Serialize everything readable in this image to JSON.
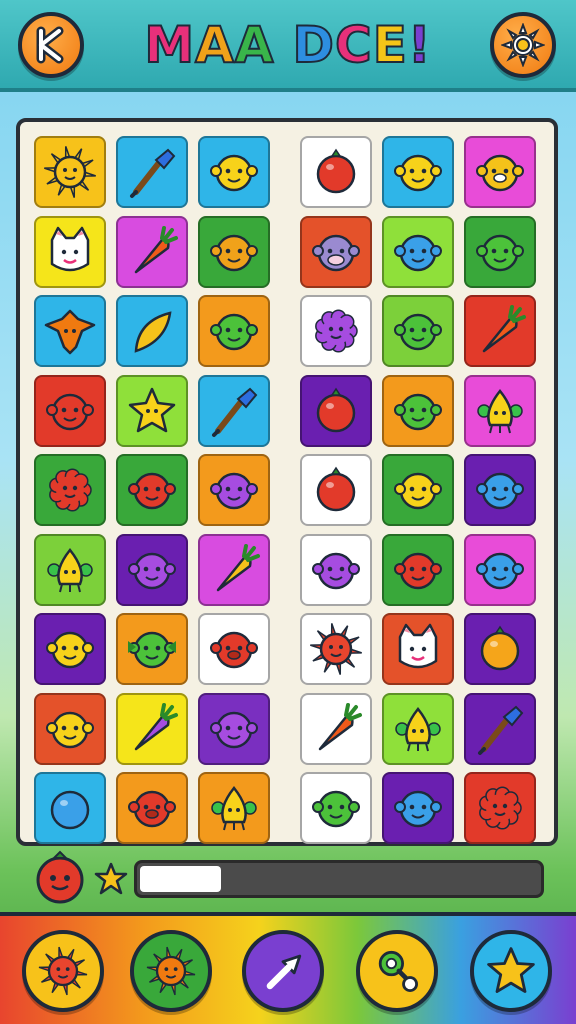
{
  "header": {
    "title_letters": [
      {
        "ch": "M",
        "color": "#e8307a"
      },
      {
        "ch": "A",
        "color": "#f0a21a"
      },
      {
        "ch": "A",
        "color": "#39b54a"
      },
      {
        "ch": " ",
        "color": "#000000"
      },
      {
        "ch": "D",
        "color": "#2d8ee0"
      },
      {
        "ch": "C",
        "color": "#e8307a"
      },
      {
        "ch": "E",
        "color": "#f5c518"
      },
      {
        "ch": "!",
        "color": "#7a3fd0"
      }
    ],
    "back_icon": "back-arrow-icon",
    "settings_icon": "sun-gear-icon"
  },
  "board": {
    "rows": [
      [
        {
          "bg": "#f7c21a",
          "icon": "sun"
        },
        {
          "bg": "#2fb5e8",
          "icon": "brush"
        },
        {
          "bg": "#2fb5e8",
          "icon": "yellow-face"
        },
        {
          "bg": "#ffffff",
          "icon": "red-ball"
        },
        {
          "bg": "#2fb5e8",
          "icon": "yellow-face"
        },
        {
          "bg": "#e84cd8",
          "icon": "dog"
        }
      ],
      [
        {
          "bg": "#f5e51a",
          "icon": "cat"
        },
        {
          "bg": "#d84ce0",
          "icon": "carrot"
        },
        {
          "bg": "#39a83a",
          "icon": "orange-face"
        },
        {
          "bg": "#e4522a",
          "icon": "cow"
        },
        {
          "bg": "#8fe03a",
          "icon": "blue-face"
        },
        {
          "bg": "#39a83a",
          "icon": "green-face"
        }
      ],
      [
        {
          "bg": "#2fb5e8",
          "icon": "bat"
        },
        {
          "bg": "#2fb5e8",
          "icon": "leaf"
        },
        {
          "bg": "#f39a1c",
          "icon": "green-face"
        },
        {
          "bg": "#ffffff",
          "icon": "purple-fluff"
        },
        {
          "bg": "#7cd03a",
          "icon": "green-face"
        },
        {
          "bg": "#e23a2a",
          "icon": "carrot"
        }
      ],
      [
        {
          "bg": "#e23a2a",
          "icon": "red-face"
        },
        {
          "bg": "#8fe03a",
          "icon": "yellow-star"
        },
        {
          "bg": "#2fb5e8",
          "icon": "brush"
        },
        {
          "bg": "#6a1fb0",
          "icon": "red-ball"
        },
        {
          "bg": "#f39a1c",
          "icon": "green-face"
        },
        {
          "bg": "#e84cd8",
          "icon": "yellow-drop"
        }
      ],
      [
        {
          "bg": "#39a83a",
          "icon": "red-fluff"
        },
        {
          "bg": "#39a83a",
          "icon": "red-face"
        },
        {
          "bg": "#f39a1c",
          "icon": "purple-face"
        },
        {
          "bg": "#ffffff",
          "icon": "red-ball"
        },
        {
          "bg": "#39a83a",
          "icon": "yellow-face"
        },
        {
          "bg": "#6a1fb0",
          "icon": "blue-face"
        }
      ],
      [
        {
          "bg": "#7cd03a",
          "icon": "yellow-drop"
        },
        {
          "bg": "#6a1fb0",
          "icon": "purple-face"
        },
        {
          "bg": "#d84ce0",
          "icon": "yellow-carrot"
        },
        {
          "bg": "#ffffff",
          "icon": "purple-face"
        },
        {
          "bg": "#39a83a",
          "icon": "red-face"
        },
        {
          "bg": "#e84cd8",
          "icon": "blue-face"
        }
      ],
      [
        {
          "bg": "#6a1fb0",
          "icon": "yellow-face"
        },
        {
          "bg": "#f39a1c",
          "icon": "green-bat"
        },
        {
          "bg": "#ffffff",
          "icon": "red-dog"
        },
        {
          "bg": "#ffffff",
          "icon": "red-sun"
        },
        {
          "bg": "#e4522a",
          "icon": "cat"
        },
        {
          "bg": "#6a1fb0",
          "icon": "orange-ball"
        }
      ],
      [
        {
          "bg": "#e4522a",
          "icon": "yellow-face"
        },
        {
          "bg": "#f5e51a",
          "icon": "eggplant"
        },
        {
          "bg": "#7a2fc0",
          "icon": "purple-face"
        },
        {
          "bg": "#ffffff",
          "icon": "carrot"
        },
        {
          "bg": "#8fe03a",
          "icon": "yellow-drop"
        },
        {
          "bg": "#6a1fb0",
          "icon": "brush"
        }
      ],
      [
        {
          "bg": "#2fb5e8",
          "icon": "blue-ball"
        },
        {
          "bg": "#f39a1c",
          "icon": "red-dog"
        },
        {
          "bg": "#f39a1c",
          "icon": "yellow-drop"
        },
        {
          "bg": "#ffffff",
          "icon": "green-face"
        },
        {
          "bg": "#6a1fb0",
          "icon": "blue-face"
        },
        {
          "bg": "#e23a2a",
          "icon": "red-fluff"
        }
      ]
    ]
  },
  "progress": {
    "fraction": 0.2,
    "target_icon": "red-ball",
    "star_icon": "star"
  },
  "toolbar": {
    "buttons": [
      {
        "name": "sun-powerup-button",
        "icon": "red-sun",
        "bg": "#f7c21a"
      },
      {
        "name": "flower-powerup-button",
        "icon": "orange-sun",
        "bg": "#39a83a"
      },
      {
        "name": "arrow-powerup-button",
        "icon": "arrow",
        "bg": "#7a3fd0"
      },
      {
        "name": "swap-powerup-button",
        "icon": "swap",
        "bg": "#f7c21a"
      },
      {
        "name": "star-powerup-button",
        "icon": "star",
        "bg": "#2fb5e8"
      }
    ]
  }
}
